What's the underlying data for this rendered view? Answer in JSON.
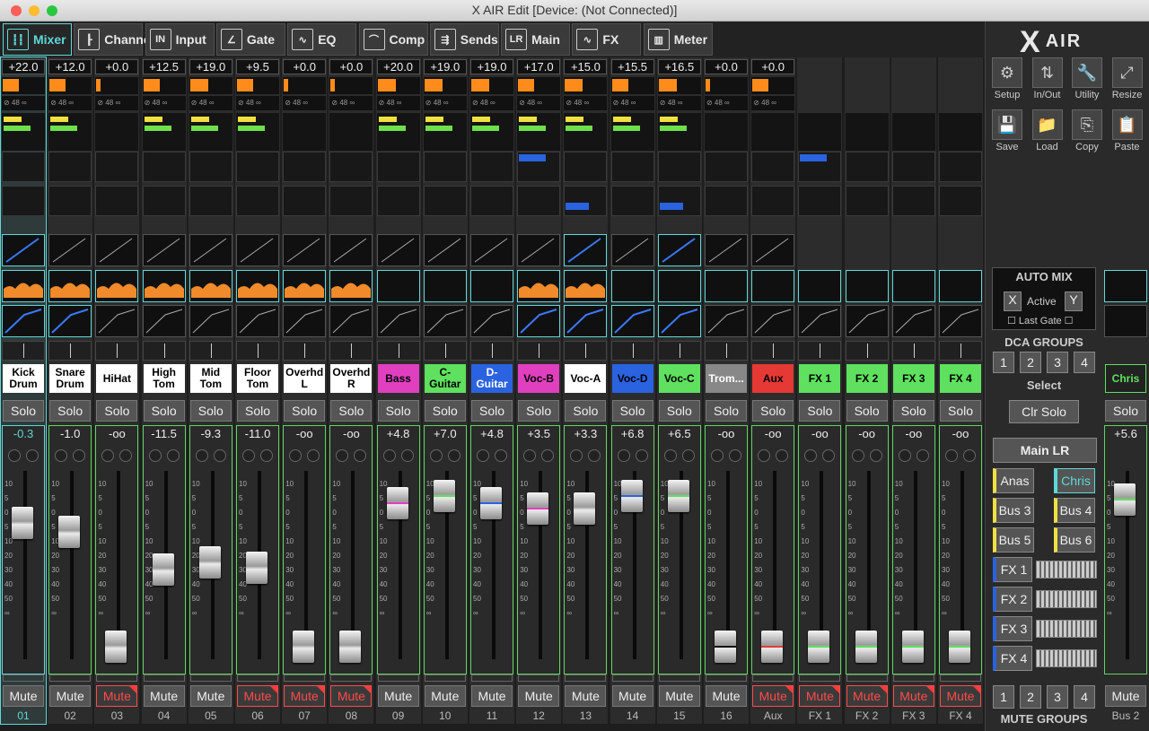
{
  "window": {
    "title": "X AIR Edit [Device: (Not Connected)]"
  },
  "tabs": [
    {
      "label": "Mixer",
      "icon": "mixer-icon",
      "active": true
    },
    {
      "label": "Channel",
      "icon": "channel-icon"
    },
    {
      "label": "Input",
      "icon": "input-icon"
    },
    {
      "label": "Gate",
      "icon": "gate-icon"
    },
    {
      "label": "EQ",
      "icon": "eq-icon"
    },
    {
      "label": "Comp",
      "icon": "comp-icon"
    },
    {
      "label": "Sends",
      "icon": "sends-icon"
    },
    {
      "label": "Main",
      "icon": "main-icon"
    },
    {
      "label": "FX",
      "icon": "fx-icon"
    },
    {
      "label": "Meter",
      "icon": "meter-icon"
    }
  ],
  "channels": [
    {
      "num": "01",
      "gain": "+22.0",
      "name": "Kick Drum",
      "name_bg": "#ffffff",
      "name_fg": "#000000",
      "fader": "-0.3",
      "mute": "Mute",
      "solo": "Solo",
      "muted": false,
      "selected": true
    },
    {
      "num": "02",
      "gain": "+12.0",
      "name": "Snare Drum",
      "name_bg": "#ffffff",
      "name_fg": "#000000",
      "fader": "-1.0",
      "mute": "Mute",
      "solo": "Solo",
      "muted": false
    },
    {
      "num": "03",
      "gain": "+0.0",
      "name": "HiHat",
      "name_bg": "#ffffff",
      "name_fg": "#000000",
      "fader": "-oo",
      "mute": "Mute",
      "solo": "Solo",
      "muted": true
    },
    {
      "num": "04",
      "gain": "+12.5",
      "name": "High Tom",
      "name_bg": "#ffffff",
      "name_fg": "#000000",
      "fader": "-11.5",
      "mute": "Mute",
      "solo": "Solo",
      "muted": false
    },
    {
      "num": "05",
      "gain": "+19.0",
      "name": "Mid Tom",
      "name_bg": "#ffffff",
      "name_fg": "#000000",
      "fader": "-9.3",
      "mute": "Mute",
      "solo": "Solo",
      "muted": false
    },
    {
      "num": "06",
      "gain": "+9.5",
      "name": "Floor Tom",
      "name_bg": "#ffffff",
      "name_fg": "#000000",
      "fader": "-11.0",
      "mute": "Mute",
      "solo": "Solo",
      "muted": true
    },
    {
      "num": "07",
      "gain": "+0.0",
      "name": "Overhd L",
      "name_bg": "#ffffff",
      "name_fg": "#000000",
      "fader": "-oo",
      "mute": "Mute",
      "solo": "Solo",
      "muted": true
    },
    {
      "num": "08",
      "gain": "+0.0",
      "name": "Overhd R",
      "name_bg": "#ffffff",
      "name_fg": "#000000",
      "fader": "-oo",
      "mute": "Mute",
      "solo": "Solo",
      "muted": true
    },
    {
      "num": "09",
      "gain": "+20.0",
      "name": "Bass",
      "name_bg": "#e040c0",
      "name_fg": "#000000",
      "fader": "+4.8",
      "mute": "Mute",
      "solo": "Solo",
      "muted": false
    },
    {
      "num": "10",
      "gain": "+19.0",
      "name": "C-Guitar",
      "name_bg": "#5fe05f",
      "name_fg": "#000000",
      "fader": "+7.0",
      "mute": "Mute",
      "solo": "Solo",
      "muted": false
    },
    {
      "num": "11",
      "gain": "+19.0",
      "name": "D-Guitar",
      "name_bg": "#2a62e0",
      "name_fg": "#ffffff",
      "fader": "+4.8",
      "mute": "Mute",
      "solo": "Solo",
      "muted": false
    },
    {
      "num": "12",
      "gain": "+17.0",
      "name": "Voc-B",
      "name_bg": "#e040c0",
      "name_fg": "#000000",
      "fader": "+3.5",
      "mute": "Mute",
      "solo": "Solo",
      "muted": false
    },
    {
      "num": "13",
      "gain": "+15.0",
      "name": "Voc-A",
      "name_bg": "#ffffff",
      "name_fg": "#000000",
      "fader": "+3.3",
      "mute": "Mute",
      "solo": "Solo",
      "muted": false
    },
    {
      "num": "14",
      "gain": "+15.5",
      "name": "Voc-D",
      "name_bg": "#2a62e0",
      "name_fg": "#000000",
      "fader": "+6.8",
      "mute": "Mute",
      "solo": "Solo",
      "muted": false
    },
    {
      "num": "15",
      "gain": "+16.5",
      "name": "Voc-C",
      "name_bg": "#5fe05f",
      "name_fg": "#000000",
      "fader": "+6.5",
      "mute": "Mute",
      "solo": "Solo",
      "muted": false
    },
    {
      "num": "16",
      "gain": "+0.0",
      "name": "Trom...",
      "name_bg": "#888888",
      "name_fg": "#ffffff",
      "fader": "-oo",
      "mute": "Mute",
      "solo": "Solo",
      "muted": false
    },
    {
      "num": "Aux",
      "gain": "+0.0",
      "name": "Aux",
      "name_bg": "#e53935",
      "name_fg": "#000000",
      "fader": "-oo",
      "mute": "Mute",
      "solo": "Solo",
      "muted": true
    },
    {
      "num": "FX 1",
      "gain": "",
      "name": "FX 1",
      "name_bg": "#5fe05f",
      "name_fg": "#000000",
      "fader": "-oo",
      "mute": "Mute",
      "solo": "Solo",
      "muted": true
    },
    {
      "num": "FX 2",
      "gain": "",
      "name": "FX 2",
      "name_bg": "#5fe05f",
      "name_fg": "#000000",
      "fader": "-oo",
      "mute": "Mute",
      "solo": "Solo",
      "muted": true
    },
    {
      "num": "FX 3",
      "gain": "",
      "name": "FX 3",
      "name_bg": "#5fe05f",
      "name_fg": "#000000",
      "fader": "-oo",
      "mute": "Mute",
      "solo": "Solo",
      "muted": true
    },
    {
      "num": "FX 4",
      "gain": "",
      "name": "FX 4",
      "name_bg": "#5fe05f",
      "name_fg": "#000000",
      "fader": "-oo",
      "mute": "Mute",
      "solo": "Solo",
      "muted": true
    }
  ],
  "phantom_label": "48",
  "fader_scale": [
    "10",
    "5",
    "0",
    "5",
    "10",
    "20",
    "30",
    "40",
    "50",
    "∞"
  ],
  "sidebar": {
    "logo": "X",
    "logo_text": "AIR",
    "utility_buttons": [
      {
        "label": "Setup",
        "icon": "gear-icon",
        "glyph": "⚙"
      },
      {
        "label": "In/Out",
        "icon": "in-out-icon",
        "glyph": "⇅"
      },
      {
        "label": "Utility",
        "icon": "wrench-icon",
        "glyph": "🔧"
      },
      {
        "label": "Resize",
        "icon": "resize-icon",
        "glyph": "⤢"
      },
      {
        "label": "Save",
        "icon": "save-icon",
        "glyph": "💾"
      },
      {
        "label": "Load",
        "icon": "folder-icon",
        "glyph": "📁"
      },
      {
        "label": "Copy",
        "icon": "copy-icon",
        "glyph": "⎘"
      },
      {
        "label": "Paste",
        "icon": "paste-icon",
        "glyph": "📋"
      }
    ],
    "automix": {
      "title": "AUTO MIX",
      "x": "X",
      "active": "Active",
      "y": "Y",
      "last_gate": "Last Gate"
    },
    "dca_title": "DCA GROUPS",
    "dca": [
      "1",
      "2",
      "3",
      "4"
    ],
    "select": "Select",
    "clr_solo": "Clr Solo",
    "main_lr": "Main LR",
    "buses": [
      "Anas",
      "Chris",
      "Bus 3",
      "Bus 4",
      "Bus 5",
      "Bus 6"
    ],
    "fx_buttons": [
      "FX 1",
      "FX 2",
      "FX 3",
      "FX 4"
    ],
    "mute_groups": [
      "1",
      "2",
      "3",
      "4"
    ],
    "mute_groups_title": "MUTE GROUPS"
  },
  "right_strip": {
    "name": "Chris",
    "solo": "Solo",
    "fader": "+5.6",
    "mute": "Mute",
    "num": "Bus 2"
  },
  "colors": {
    "accent": "#5ed8d8",
    "mute_on": "#ff4a4a",
    "gain": "#ff8c1a"
  }
}
